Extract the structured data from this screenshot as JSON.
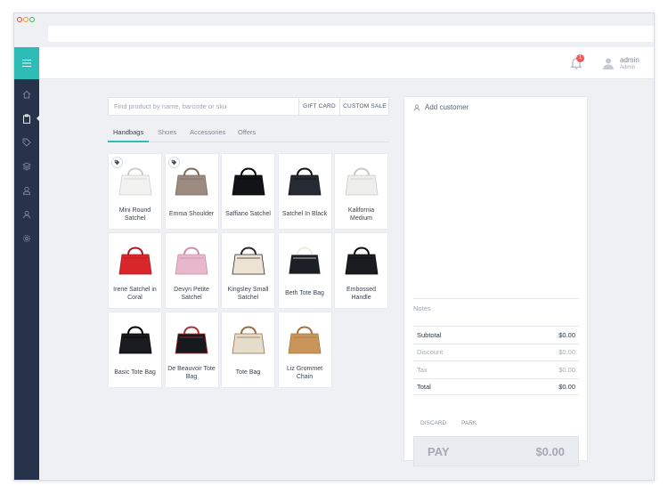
{
  "colors": {
    "accent": "#2dbdb6",
    "sidebar": "#26334a",
    "badge": "#ef5a5a"
  },
  "header": {
    "notification_count": "1",
    "user_name": "admin",
    "user_role": "Admin"
  },
  "search": {
    "placeholder": "Find product by name, barcode or sku",
    "gift_card_label": "GIFT CARD",
    "custom_sale_label": "CUSTOM SALE"
  },
  "tabs": [
    "Handbags",
    "Shoes",
    "Accessories",
    "Offers"
  ],
  "products": [
    {
      "name": "Mini Round Satchel",
      "tagged": true,
      "color": "#f2f2f0",
      "accent": "#cfcfcf"
    },
    {
      "name": "Emma Shoulder",
      "tagged": true,
      "color": "#9c8b80",
      "accent": "#7a6a60"
    },
    {
      "name": "Saffiano Satchel",
      "tagged": false,
      "color": "#111317",
      "accent": "#000"
    },
    {
      "name": "Satchel In Black",
      "tagged": false,
      "color": "#262a33",
      "accent": "#111"
    },
    {
      "name": "Kalifornia Medium",
      "tagged": false,
      "color": "#eeeeec",
      "accent": "#c8c8c5"
    },
    {
      "name": "Irene Satchel in Coral",
      "tagged": false,
      "color": "#d9262b",
      "accent": "#a81b1f"
    },
    {
      "name": "Devyn Petite Satchel",
      "tagged": false,
      "color": "#e8b7cb",
      "accent": "#c98fa8"
    },
    {
      "name": "Kingsley Small Satchel",
      "tagged": false,
      "color": "#ece3d3",
      "accent": "#2a2a2a"
    },
    {
      "name": "Beth Tote Bag",
      "tagged": false,
      "color": "#1d1f26",
      "accent": "#f1ece1"
    },
    {
      "name": "Embossed Handle",
      "tagged": false,
      "color": "#1b1c20",
      "accent": "#0a0a0a"
    },
    {
      "name": "Basic Tote Bag",
      "tagged": false,
      "color": "#1a1b1f",
      "accent": "#000"
    },
    {
      "name": "De Beauvoir Tote Bag",
      "tagged": false,
      "color": "#18191d",
      "accent": "#b03030"
    },
    {
      "name": "Tote Bag",
      "tagged": false,
      "color": "#e6dccb",
      "accent": "#9a6b3e"
    },
    {
      "name": "Liz Grommet Chain",
      "tagged": false,
      "color": "#c9955a",
      "accent": "#a3743f"
    }
  ],
  "cart": {
    "add_customer_label": "Add customer",
    "notes_label": "Notes",
    "subtotal_label": "Subtotal",
    "subtotal_value": "$0.00",
    "discount_label": "Discount",
    "discount_value": "$0.00",
    "tax_label": "Tax",
    "tax_value": "$0.00",
    "total_label": "Total",
    "total_value": "$0.00",
    "discard_label": "DISCARD",
    "park_label": "PARK",
    "pay_label": "PAY",
    "pay_value": "$0.00"
  }
}
